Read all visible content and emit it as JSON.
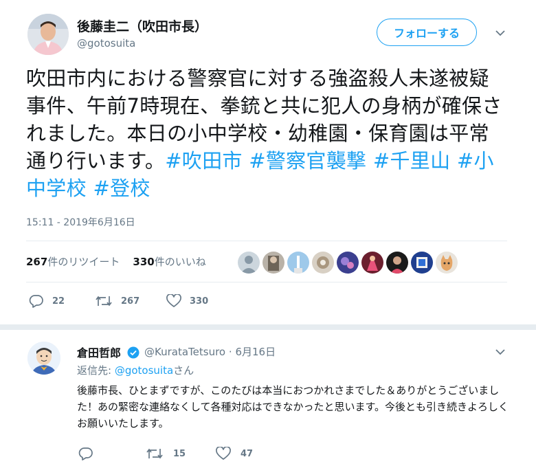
{
  "tweet": {
    "display_name": "後藤圭二（吹田市長）",
    "handle": "@gotosuita",
    "follow_label": "フォローする",
    "text_parts": [
      {
        "text": "吹田市内における警察官に対する強盗殺人未遂被疑事件、午前7時現在、拳銃と共に犯人の身柄が確保されました。本日の小中学校・幼稚園・保育園は平常通り行います。",
        "kind": "plain"
      },
      {
        "text": "#吹田市",
        "kind": "hashtag"
      },
      {
        "text": " ",
        "kind": "plain"
      },
      {
        "text": "#警察官襲撃",
        "kind": "hashtag"
      },
      {
        "text": " ",
        "kind": "plain"
      },
      {
        "text": "#千里山",
        "kind": "hashtag"
      },
      {
        "text": " ",
        "kind": "plain"
      },
      {
        "text": "#小中学校",
        "kind": "hashtag"
      },
      {
        "text": " ",
        "kind": "plain"
      },
      {
        "text": "#登校",
        "kind": "hashtag"
      }
    ],
    "timestamp": "15:11 - 2019年6月16日",
    "retweet_count": "267",
    "retweet_label": "件のリツイート",
    "like_count": "330",
    "like_label": "件のいいね",
    "actions": {
      "reply": "22",
      "retweet": "267",
      "like": "330"
    },
    "likers": [
      "default-avatar",
      "avatar-2",
      "avatar-3",
      "avatar-4",
      "avatar-5",
      "avatar-6",
      "avatar-7",
      "avatar-8",
      "avatar-9"
    ]
  },
  "reply": {
    "display_name": "倉田哲郎",
    "handle": "@KurataTetsuro",
    "separator": "·",
    "date": "6月16日",
    "replying_prefix": "返信先:",
    "replying_handle": "@gotosuita",
    "replying_suffix": "さん",
    "text": "後藤市長、ひとまずですが、このたびは本当におつかれさまでした＆ありがとうございました！あの緊密な連絡なくして各種対応はできなかったと思います。今後とも引き続きよろしくお願いいたします。",
    "actions": {
      "reply": "",
      "retweet": "15",
      "like": "47"
    }
  },
  "colors": {
    "accent": "#1da1f2",
    "muted": "#657786",
    "text": "#14171a",
    "divider": "#e6ecf0"
  }
}
